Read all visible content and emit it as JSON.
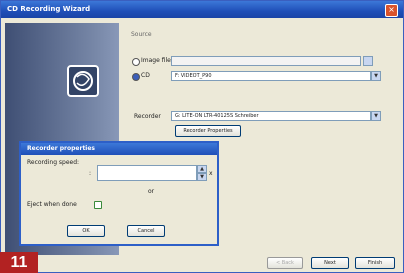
{
  "window": {
    "title": "CD Recording Wizard",
    "close_glyph": "×"
  },
  "source": {
    "heading": "Source",
    "image_file_label": "Image file",
    "image_file_value": "",
    "cd_label": "CD",
    "cd_value": "F: VIDEOT_P90"
  },
  "recorder": {
    "label": "Recorder",
    "value": "G: LITE-ON LTR-40125S Schreiber",
    "properties_button": "Recorder Properties"
  },
  "dialog": {
    "title": "Recorder properties",
    "speed_label": "Recording speed:",
    "speed_value": "",
    "speed_unit": "x",
    "speed_note": "or",
    "eject_label": "Eject when done",
    "ok_label": "OK",
    "cancel_label": "Cancel"
  },
  "footer": {
    "back_label": "< Back",
    "next_label": "Next",
    "finish_label": "Finish"
  },
  "step_badge": "11",
  "colors": {
    "accent": "#1f4fb8",
    "badge": "#b22222"
  }
}
